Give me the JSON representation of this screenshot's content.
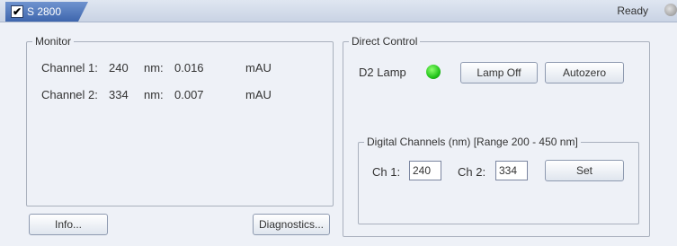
{
  "header": {
    "tab_label": "S 2800",
    "tab_checked": true,
    "status": "Ready"
  },
  "monitor": {
    "title": "Monitor",
    "channels": [
      {
        "label": "Channel 1:",
        "wavelength": "240",
        "wl_unit": "nm:",
        "value": "0.016",
        "unit": "mAU"
      },
      {
        "label": "Channel 2:",
        "wavelength": "334",
        "wl_unit": "nm:",
        "value": "0.007",
        "unit": "mAU"
      }
    ],
    "info_label": "Info...",
    "diagnostics_label": "Diagnostics..."
  },
  "direct_control": {
    "title": "Direct Control",
    "lamp_label": "D2 Lamp",
    "lamp_color": "#22c41a",
    "lamp_off_label": "Lamp Off",
    "autozero_label": "Autozero",
    "digital": {
      "title": "Digital Channels (nm) [Range 200 - 450 nm]",
      "ch1_label": "Ch 1:",
      "ch1_value": "240",
      "ch2_label": "Ch 2:",
      "ch2_value": "334",
      "set_label": "Set"
    }
  }
}
